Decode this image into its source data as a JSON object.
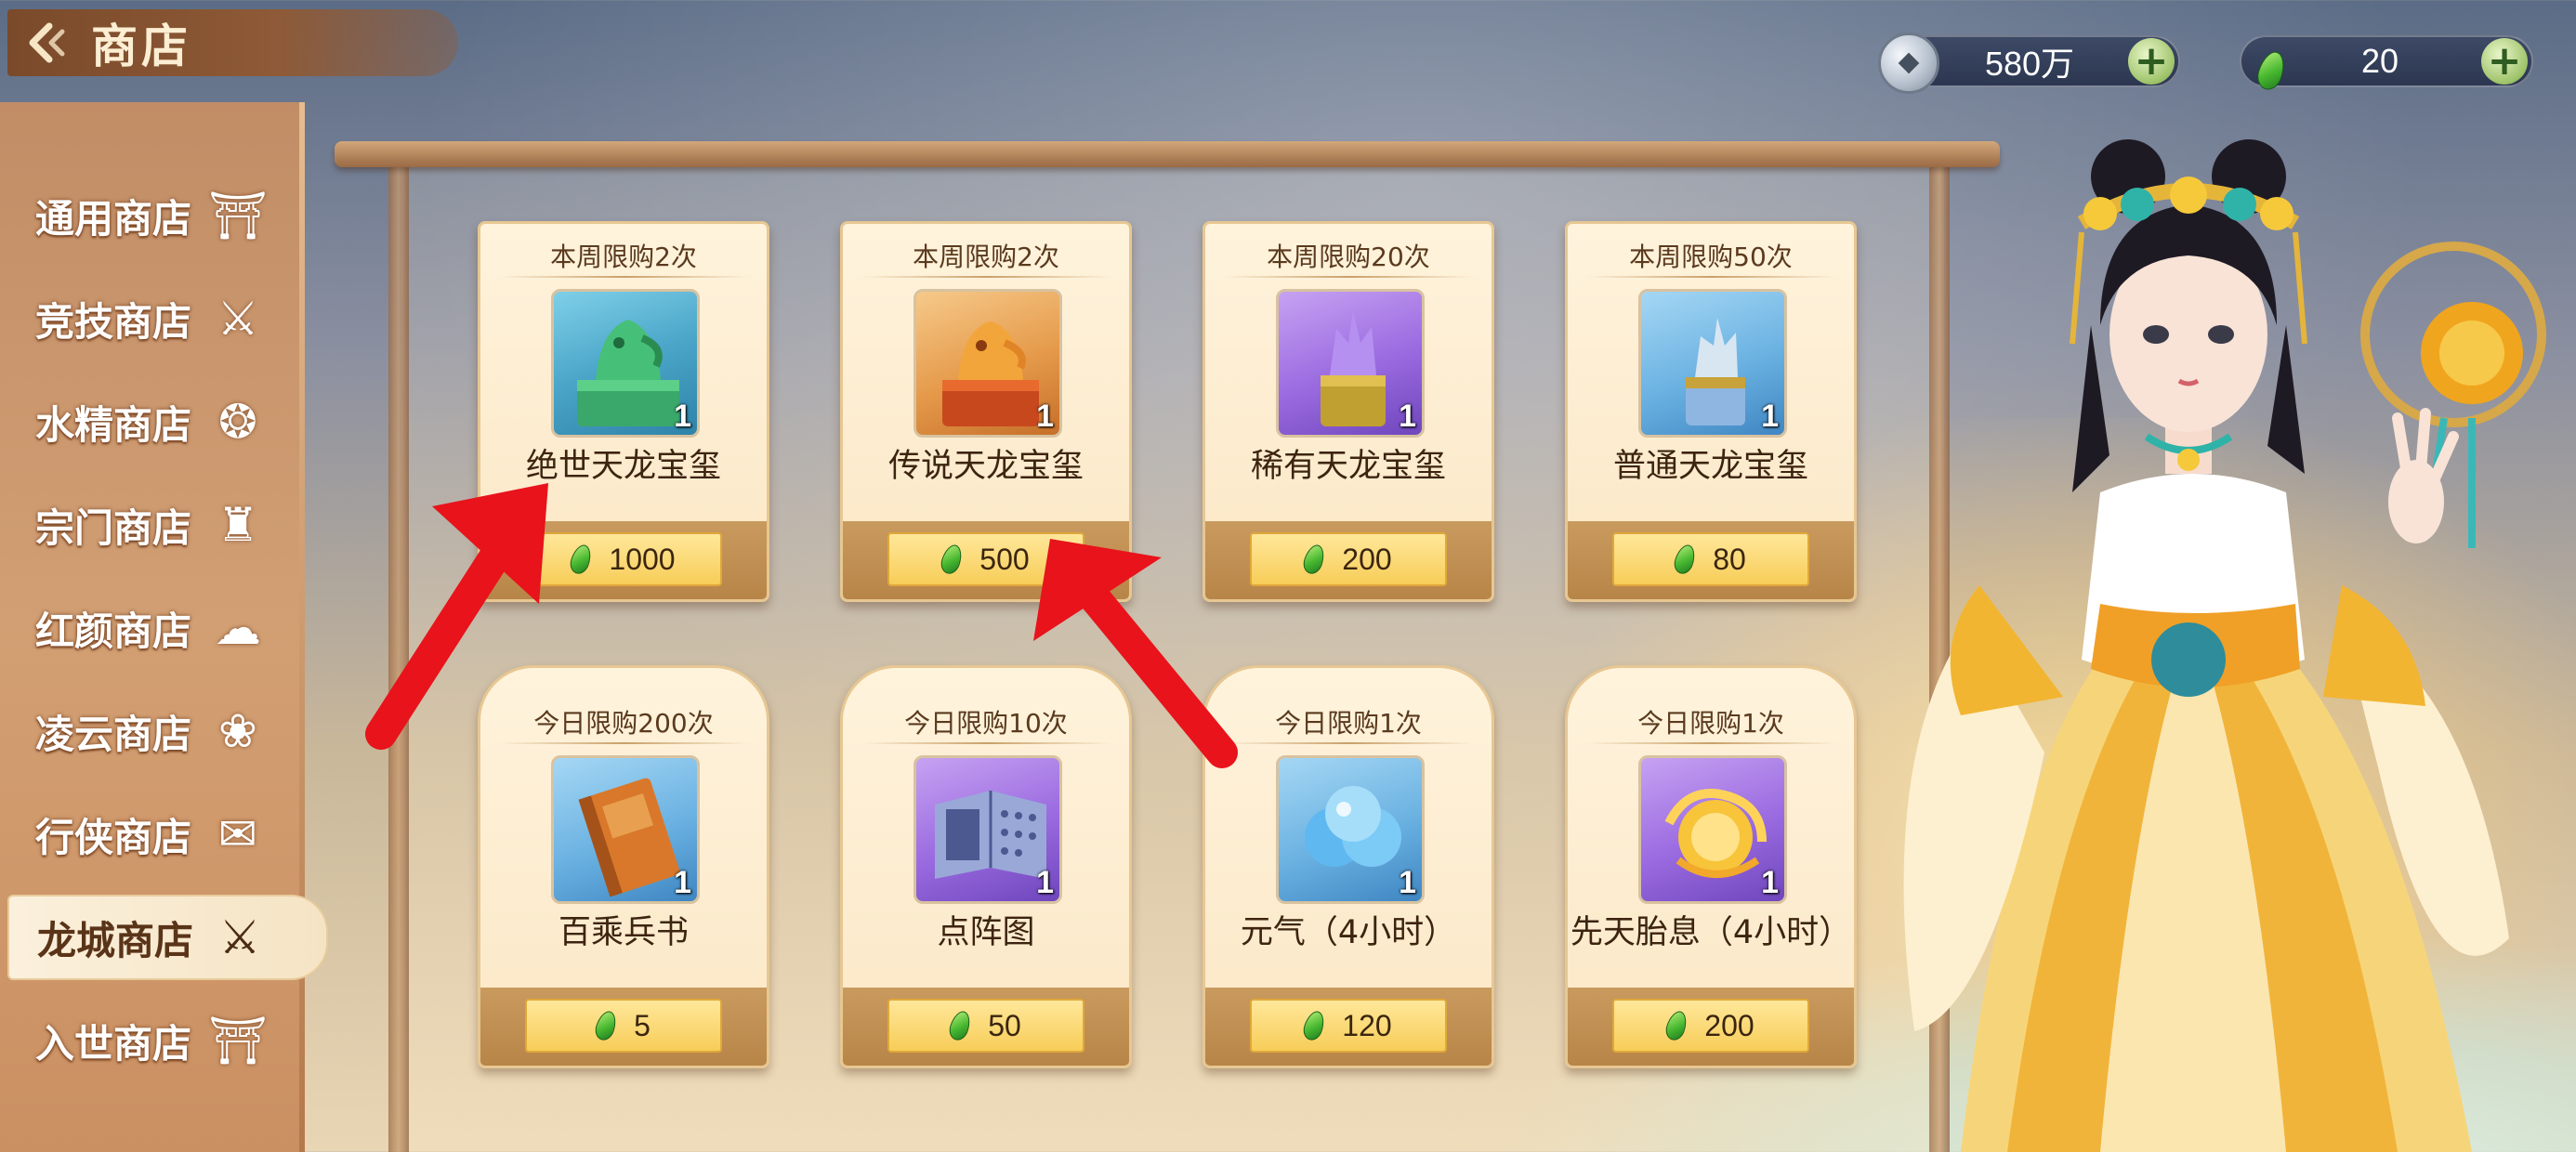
{
  "header": {
    "back_icon": "back-arrow-icon",
    "title": "商店"
  },
  "currency": {
    "silver": {
      "icon": "silver-coin-icon",
      "value": "580万"
    },
    "jade": {
      "icon": "jade-gem-icon",
      "value": "20"
    }
  },
  "sidebar": {
    "items": [
      {
        "label": "通用商店",
        "icon": "⛩",
        "active": false
      },
      {
        "label": "竞技商店",
        "icon": "⚔",
        "active": false
      },
      {
        "label": "水精商店",
        "icon": "❂",
        "active": false
      },
      {
        "label": "宗门商店",
        "icon": "♜",
        "active": false
      },
      {
        "label": "红颜商店",
        "icon": "☁",
        "active": false
      },
      {
        "label": "凌云商店",
        "icon": "❀",
        "active": false
      },
      {
        "label": "行侠商店",
        "icon": "✉",
        "active": false
      },
      {
        "label": "龙城商店",
        "icon": "⚔",
        "active": true
      },
      {
        "label": "入世商店",
        "icon": "⛩",
        "active": false
      }
    ]
  },
  "shop": {
    "items": [
      {
        "limit": "本周限购2次",
        "name": "绝世天龙宝玺",
        "count": "1",
        "price": "1000",
        "art": "green-dragon-seal"
      },
      {
        "limit": "本周限购2次",
        "name": "传说天龙宝玺",
        "count": "1",
        "price": "500",
        "art": "gold-dragon-seal"
      },
      {
        "limit": "本周限购20次",
        "name": "稀有天龙宝玺",
        "count": "1",
        "price": "200",
        "art": "purple-dragon-seal"
      },
      {
        "limit": "本周限购50次",
        "name": "普通天龙宝玺",
        "count": "1",
        "price": "80",
        "art": "blue-dragon-seal"
      },
      {
        "limit": "今日限购200次",
        "name": "百乘兵书",
        "count": "1",
        "price": "5",
        "art": "war-book"
      },
      {
        "limit": "今日限购10次",
        "name": "点阵图",
        "count": "1",
        "price": "50",
        "art": "formation-scroll"
      },
      {
        "limit": "今日限购1次",
        "name": "元气（4小时）",
        "count": "1",
        "price": "120",
        "art": "energy-orb"
      },
      {
        "limit": "今日限购1次",
        "name": "先天胎息（4小时）",
        "count": "1",
        "price": "200",
        "art": "golden-breath"
      }
    ]
  },
  "colors": {
    "annotation_arrow": "#e8131b",
    "sidebar": "#c98f62",
    "card": "#fff3dc",
    "price_button": "#f7cd58"
  }
}
